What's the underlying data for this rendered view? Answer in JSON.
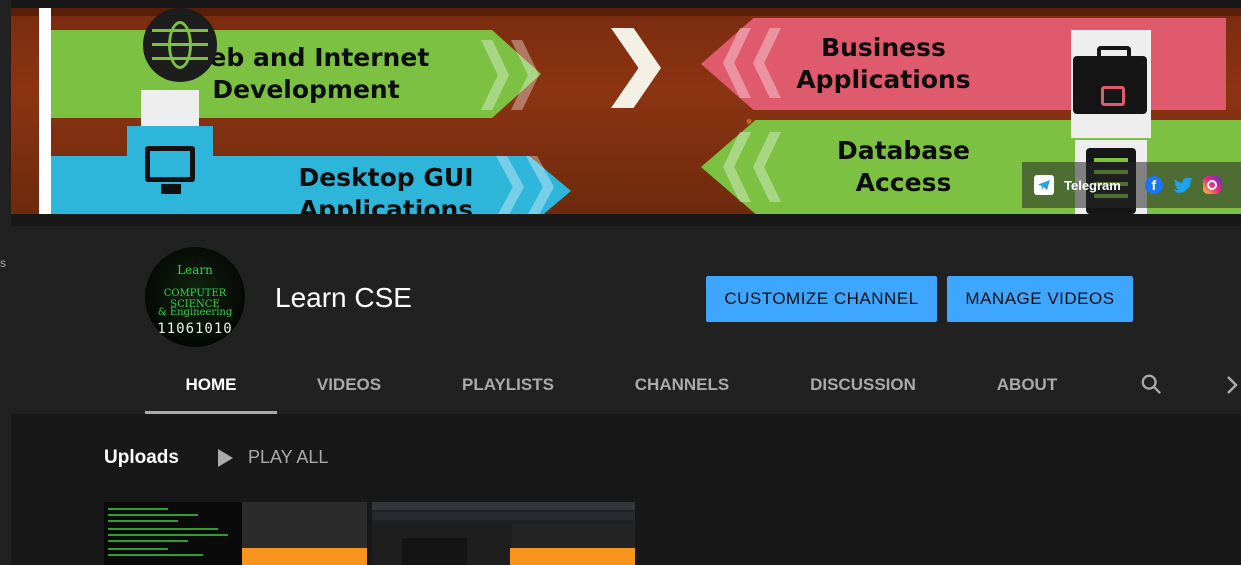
{
  "banner": {
    "tiles": {
      "web": "Web and Internet Development",
      "business": "Business Applications",
      "desktop": "Desktop GUI Applications",
      "database": "Database Access"
    },
    "links": [
      {
        "label": "Telegram",
        "icon": "telegram-icon"
      },
      {
        "icon": "facebook-icon"
      },
      {
        "icon": "twitter-icon"
      },
      {
        "icon": "instagram-icon"
      }
    ]
  },
  "channel": {
    "avatar_text": [
      "Learn",
      "COMPUTER SCIENCE",
      "& Engineering",
      "11061010"
    ],
    "name": "Learn CSE",
    "customize_label": "CUSTOMIZE CHANNEL",
    "manage_label": "MANAGE VIDEOS"
  },
  "tabs": [
    {
      "label": "HOME",
      "active": true
    },
    {
      "label": "VIDEOS"
    },
    {
      "label": "PLAYLISTS"
    },
    {
      "label": "CHANNELS"
    },
    {
      "label": "DISCUSSION"
    },
    {
      "label": "ABOUT"
    }
  ],
  "uploads": {
    "title": "Uploads",
    "play_all": "PLAY ALL"
  },
  "left_rail_char": "s",
  "colors": {
    "accent_button": "#3ea6ff",
    "page_bg": "#181818",
    "header_bg": "#212121"
  }
}
